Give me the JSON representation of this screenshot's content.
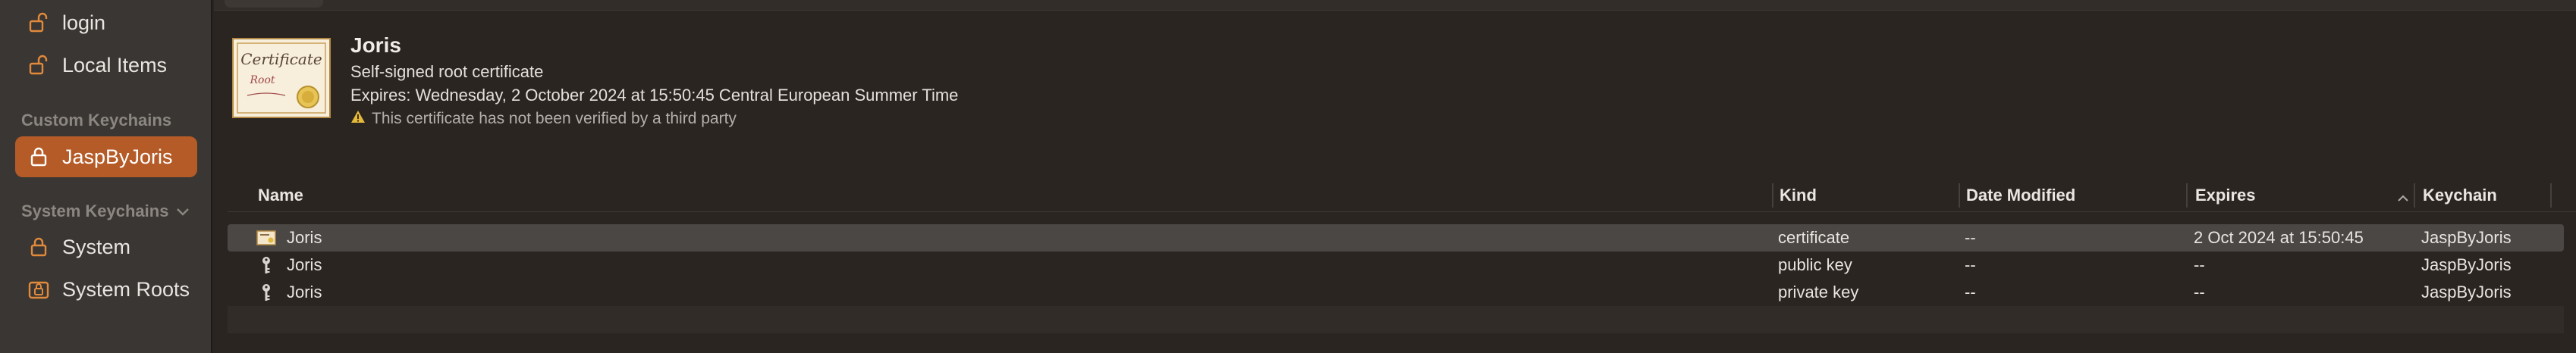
{
  "sidebar": {
    "items_top": [
      {
        "label": "login",
        "icon": "unlocked-lock-icon"
      },
      {
        "label": "Local Items",
        "icon": "unlocked-lock-icon"
      }
    ],
    "custom_section": "Custom Keychains",
    "custom_items": [
      {
        "label": "JaspByJoris",
        "icon": "lock-icon",
        "selected": true
      }
    ],
    "system_section": "System Keychains",
    "system_items": [
      {
        "label": "System",
        "icon": "lock-icon"
      },
      {
        "label": "System Roots",
        "icon": "system-roots-icon"
      }
    ]
  },
  "certificate": {
    "title": "Joris",
    "subtitle": "Self-signed root certificate",
    "expires": "Expires: Wednesday, 2 October 2024 at 15:50:45 Central European Summer Time",
    "warning": "This certificate has not been verified by a third party",
    "icon_text_top": "Certificate",
    "icon_text_bottom": "Root"
  },
  "table": {
    "columns": {
      "name": "Name",
      "kind": "Kind",
      "date_modified": "Date Modified",
      "expires": "Expires",
      "keychain": "Keychain"
    },
    "rows": [
      {
        "name": "Joris",
        "kind": "certificate",
        "date_modified": "--",
        "expires": "2 Oct 2024 at 15:50:45",
        "keychain": "JaspByJoris",
        "icon": "certificate-icon"
      },
      {
        "name": "Joris",
        "kind": "public key",
        "date_modified": "--",
        "expires": "--",
        "keychain": "JaspByJoris",
        "icon": "key-icon"
      },
      {
        "name": "Joris",
        "kind": "private key",
        "date_modified": "--",
        "expires": "--",
        "keychain": "JaspByJoris",
        "icon": "key-icon"
      }
    ]
  },
  "colors": {
    "accent": "#b55b27",
    "sidebar_bg": "#3a3633",
    "main_bg": "#2b2522",
    "selected_row": "#4b4744"
  }
}
